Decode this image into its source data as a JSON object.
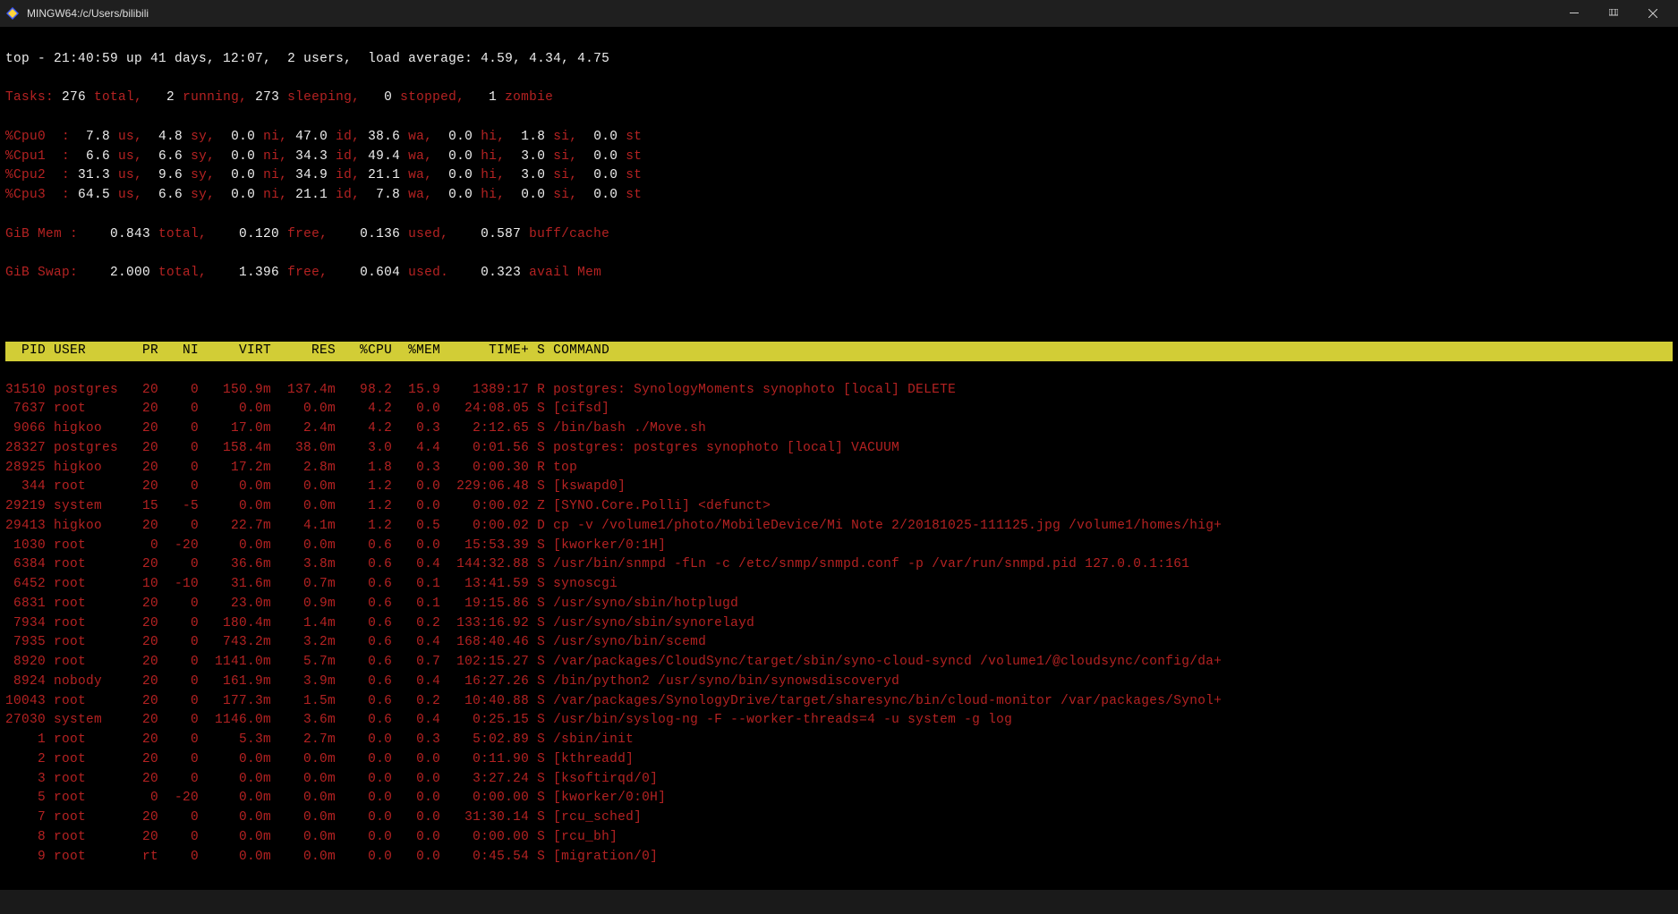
{
  "window": {
    "title": "MINGW64:/c/Users/bilibili"
  },
  "top": {
    "line1_prefix": "top - ",
    "time": "21:40:59",
    "up_label": " up ",
    "uptime": "41 days, 12:07",
    "users": "  2 users,",
    "load_label": "  load average: ",
    "load": "4.59, 4.34, 4.75"
  },
  "tasks": {
    "label": "Tasks:",
    "total_v": " 276 ",
    "total_l": "total,",
    "run_v": "   2 ",
    "run_l": "running,",
    "sleep_v": " 273 ",
    "sleep_l": "sleeping,",
    "stop_v": "   0 ",
    "stop_l": "stopped,",
    "zom_v": "   1 ",
    "zom_l": "zombie"
  },
  "cpus": [
    {
      "name": "%Cpu0  :",
      "us": "  7.8 ",
      "sy": "  4.8 ",
      "ni": "  0.0 ",
      "id": " 47.0 ",
      "wa": " 38.6 ",
      "hi": "  0.0 ",
      "si": "  1.8 ",
      "st": "  0.0 "
    },
    {
      "name": "%Cpu1  :",
      "us": "  6.6 ",
      "sy": "  6.6 ",
      "ni": "  0.0 ",
      "id": " 34.3 ",
      "wa": " 49.4 ",
      "hi": "  0.0 ",
      "si": "  3.0 ",
      "st": "  0.0 "
    },
    {
      "name": "%Cpu2  :",
      "us": " 31.3 ",
      "sy": "  9.6 ",
      "ni": "  0.0 ",
      "id": " 34.9 ",
      "wa": " 21.1 ",
      "hi": "  0.0 ",
      "si": "  3.0 ",
      "st": "  0.0 "
    },
    {
      "name": "%Cpu3  :",
      "us": " 64.5 ",
      "sy": "  6.6 ",
      "ni": "  0.0 ",
      "id": " 21.1 ",
      "wa": "  7.8 ",
      "hi": "  0.0 ",
      "si": "  0.0 ",
      "st": "  0.0 "
    }
  ],
  "cpu_labels": {
    "us": "us,",
    "sy": "sy,",
    "ni": "ni,",
    "id": "id,",
    "wa": "wa,",
    "hi": "hi,",
    "si": "si,",
    "st": "st"
  },
  "mem": {
    "label": "GiB Mem :",
    "total_v": "    0.843 ",
    "total_l": "total,",
    "free_v": "    0.120 ",
    "free_l": "free,",
    "used_v": "    0.136 ",
    "used_l": "used,",
    "buff_v": "    0.587 ",
    "buff_l": "buff/cache"
  },
  "swap": {
    "label": "GiB Swap:",
    "total_v": "    2.000 ",
    "total_l": "total,",
    "free_v": "    1.396 ",
    "free_l": "free,",
    "used_v": "    0.604 ",
    "used_l": "used.",
    "avail_v": "    0.323 ",
    "avail_l": "avail Mem"
  },
  "columns": [
    "PID",
    "USER",
    "PR",
    "NI",
    "VIRT",
    "RES",
    "%CPU",
    "%MEM",
    "TIME+",
    "S",
    "COMMAND"
  ],
  "procs": [
    {
      "pid": "31510",
      "user": "postgres",
      "pr": "20",
      "ni": "0",
      "virt": "150.9m",
      "res": "137.4m",
      "cpu": "98.2",
      "mem": "15.9",
      "time": "1389:17",
      "s": "R",
      "cmd": "postgres: SynologyMoments synophoto [local] DELETE"
    },
    {
      "pid": "7637",
      "user": "root",
      "pr": "20",
      "ni": "0",
      "virt": "0.0m",
      "res": "0.0m",
      "cpu": "4.2",
      "mem": "0.0",
      "time": "24:08.05",
      "s": "S",
      "cmd": "[cifsd]"
    },
    {
      "pid": "9066",
      "user": "higkoo",
      "pr": "20",
      "ni": "0",
      "virt": "17.0m",
      "res": "2.4m",
      "cpu": "4.2",
      "mem": "0.3",
      "time": "2:12.65",
      "s": "S",
      "cmd": "/bin/bash ./Move.sh"
    },
    {
      "pid": "28327",
      "user": "postgres",
      "pr": "20",
      "ni": "0",
      "virt": "158.4m",
      "res": "38.0m",
      "cpu": "3.0",
      "mem": "4.4",
      "time": "0:01.56",
      "s": "S",
      "cmd": "postgres: postgres synophoto [local] VACUUM"
    },
    {
      "pid": "28925",
      "user": "higkoo",
      "pr": "20",
      "ni": "0",
      "virt": "17.2m",
      "res": "2.8m",
      "cpu": "1.8",
      "mem": "0.3",
      "time": "0:00.30",
      "s": "R",
      "cmd": "top"
    },
    {
      "pid": "344",
      "user": "root",
      "pr": "20",
      "ni": "0",
      "virt": "0.0m",
      "res": "0.0m",
      "cpu": "1.2",
      "mem": "0.0",
      "time": "229:06.48",
      "s": "S",
      "cmd": "[kswapd0]"
    },
    {
      "pid": "29219",
      "user": "system",
      "pr": "15",
      "ni": "-5",
      "virt": "0.0m",
      "res": "0.0m",
      "cpu": "1.2",
      "mem": "0.0",
      "time": "0:00.02",
      "s": "Z",
      "cmd": "[SYNO.Core.Polli] <defunct>"
    },
    {
      "pid": "29413",
      "user": "higkoo",
      "pr": "20",
      "ni": "0",
      "virt": "22.7m",
      "res": "4.1m",
      "cpu": "1.2",
      "mem": "0.5",
      "time": "0:00.02",
      "s": "D",
      "cmd": "cp -v /volume1/photo/MobileDevice/Mi Note 2/20181025-111125.jpg /volume1/homes/hig+"
    },
    {
      "pid": "1030",
      "user": "root",
      "pr": "0",
      "ni": "-20",
      "virt": "0.0m",
      "res": "0.0m",
      "cpu": "0.6",
      "mem": "0.0",
      "time": "15:53.39",
      "s": "S",
      "cmd": "[kworker/0:1H]"
    },
    {
      "pid": "6384",
      "user": "root",
      "pr": "20",
      "ni": "0",
      "virt": "36.6m",
      "res": "3.8m",
      "cpu": "0.6",
      "mem": "0.4",
      "time": "144:32.88",
      "s": "S",
      "cmd": "/usr/bin/snmpd -fLn -c /etc/snmp/snmpd.conf -p /var/run/snmpd.pid 127.0.0.1:161"
    },
    {
      "pid": "6452",
      "user": "root",
      "pr": "10",
      "ni": "-10",
      "virt": "31.6m",
      "res": "0.7m",
      "cpu": "0.6",
      "mem": "0.1",
      "time": "13:41.59",
      "s": "S",
      "cmd": "synoscgi"
    },
    {
      "pid": "6831",
      "user": "root",
      "pr": "20",
      "ni": "0",
      "virt": "23.0m",
      "res": "0.9m",
      "cpu": "0.6",
      "mem": "0.1",
      "time": "19:15.86",
      "s": "S",
      "cmd": "/usr/syno/sbin/hotplugd"
    },
    {
      "pid": "7934",
      "user": "root",
      "pr": "20",
      "ni": "0",
      "virt": "180.4m",
      "res": "1.4m",
      "cpu": "0.6",
      "mem": "0.2",
      "time": "133:16.92",
      "s": "S",
      "cmd": "/usr/syno/sbin/synorelayd"
    },
    {
      "pid": "7935",
      "user": "root",
      "pr": "20",
      "ni": "0",
      "virt": "743.2m",
      "res": "3.2m",
      "cpu": "0.6",
      "mem": "0.4",
      "time": "168:40.46",
      "s": "S",
      "cmd": "/usr/syno/bin/scemd"
    },
    {
      "pid": "8920",
      "user": "root",
      "pr": "20",
      "ni": "0",
      "virt": "1141.0m",
      "res": "5.7m",
      "cpu": "0.6",
      "mem": "0.7",
      "time": "102:15.27",
      "s": "S",
      "cmd": "/var/packages/CloudSync/target/sbin/syno-cloud-syncd /volume1/@cloudsync/config/da+"
    },
    {
      "pid": "8924",
      "user": "nobody",
      "pr": "20",
      "ni": "0",
      "virt": "161.9m",
      "res": "3.9m",
      "cpu": "0.6",
      "mem": "0.4",
      "time": "16:27.26",
      "s": "S",
      "cmd": "/bin/python2 /usr/syno/bin/synowsdiscoveryd"
    },
    {
      "pid": "10043",
      "user": "root",
      "pr": "20",
      "ni": "0",
      "virt": "177.3m",
      "res": "1.5m",
      "cpu": "0.6",
      "mem": "0.2",
      "time": "10:40.88",
      "s": "S",
      "cmd": "/var/packages/SynologyDrive/target/sharesync/bin/cloud-monitor /var/packages/Synol+"
    },
    {
      "pid": "27030",
      "user": "system",
      "pr": "20",
      "ni": "0",
      "virt": "1146.0m",
      "res": "3.6m",
      "cpu": "0.6",
      "mem": "0.4",
      "time": "0:25.15",
      "s": "S",
      "cmd": "/usr/bin/syslog-ng -F --worker-threads=4 -u system -g log"
    },
    {
      "pid": "1",
      "user": "root",
      "pr": "20",
      "ni": "0",
      "virt": "5.3m",
      "res": "2.7m",
      "cpu": "0.0",
      "mem": "0.3",
      "time": "5:02.89",
      "s": "S",
      "cmd": "/sbin/init"
    },
    {
      "pid": "2",
      "user": "root",
      "pr": "20",
      "ni": "0",
      "virt": "0.0m",
      "res": "0.0m",
      "cpu": "0.0",
      "mem": "0.0",
      "time": "0:11.90",
      "s": "S",
      "cmd": "[kthreadd]"
    },
    {
      "pid": "3",
      "user": "root",
      "pr": "20",
      "ni": "0",
      "virt": "0.0m",
      "res": "0.0m",
      "cpu": "0.0",
      "mem": "0.0",
      "time": "3:27.24",
      "s": "S",
      "cmd": "[ksoftirqd/0]"
    },
    {
      "pid": "5",
      "user": "root",
      "pr": "0",
      "ni": "-20",
      "virt": "0.0m",
      "res": "0.0m",
      "cpu": "0.0",
      "mem": "0.0",
      "time": "0:00.00",
      "s": "S",
      "cmd": "[kworker/0:0H]"
    },
    {
      "pid": "7",
      "user": "root",
      "pr": "20",
      "ni": "0",
      "virt": "0.0m",
      "res": "0.0m",
      "cpu": "0.0",
      "mem": "0.0",
      "time": "31:30.14",
      "s": "S",
      "cmd": "[rcu_sched]"
    },
    {
      "pid": "8",
      "user": "root",
      "pr": "20",
      "ni": "0",
      "virt": "0.0m",
      "res": "0.0m",
      "cpu": "0.0",
      "mem": "0.0",
      "time": "0:00.00",
      "s": "S",
      "cmd": "[rcu_bh]"
    },
    {
      "pid": "9",
      "user": "root",
      "pr": "rt",
      "ni": "0",
      "virt": "0.0m",
      "res": "0.0m",
      "cpu": "0.0",
      "mem": "0.0",
      "time": "0:45.54",
      "s": "S",
      "cmd": "[migration/0]"
    }
  ]
}
